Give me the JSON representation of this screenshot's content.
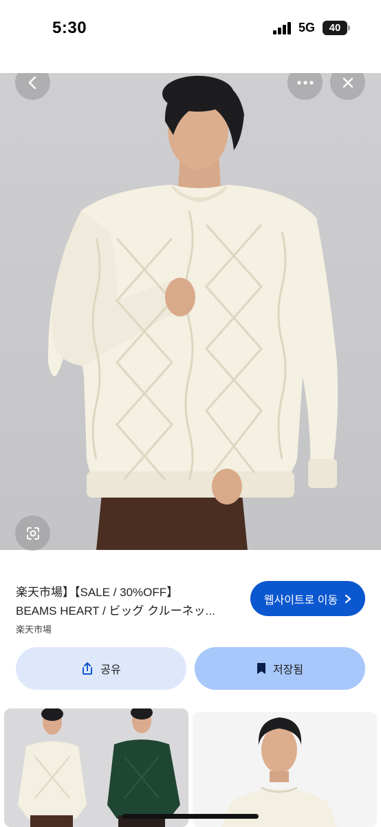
{
  "status_bar": {
    "time": "5:30",
    "network": "5G",
    "battery": "40"
  },
  "hero": {
    "image": "cream-cable-knit-sweater-model-photo"
  },
  "product": {
    "title_line1": "楽天市場】【SALE / 30%OFF】",
    "title_line2": "BEAMS HEART / ビッグ クルーネッ...",
    "source": "楽天市場"
  },
  "actions": {
    "visit_label": "웹사이트로 이동",
    "share_label": "공유",
    "saved_label": "저장됨"
  },
  "colors": {
    "primary": "#0b57d0",
    "share_bg": "#dfe8fb",
    "saved_bg": "#a8c7fa"
  }
}
